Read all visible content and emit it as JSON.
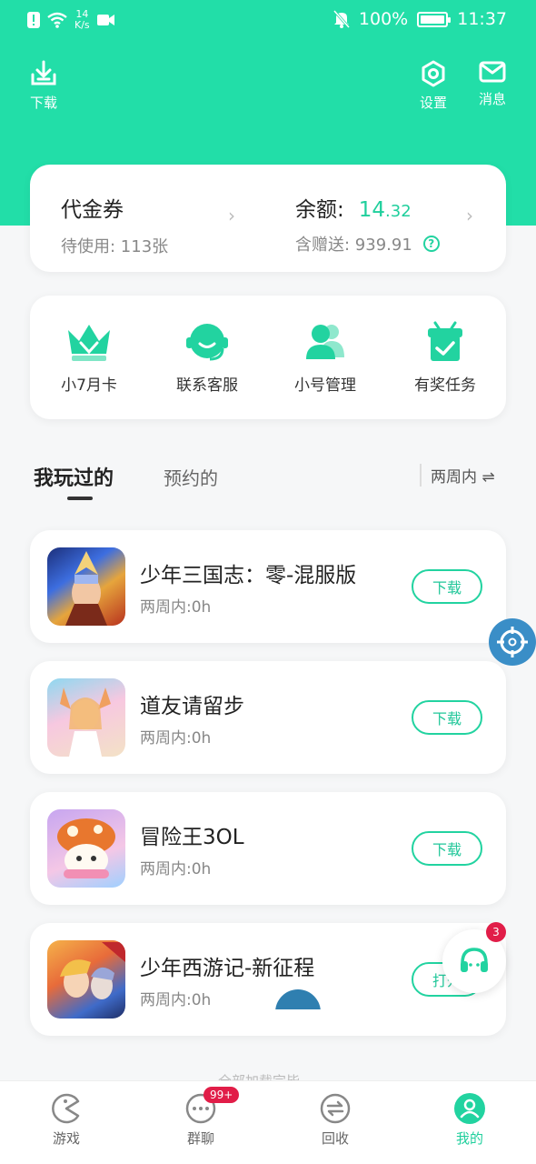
{
  "status_bar": {
    "net_speed_value": "14",
    "net_speed_unit": "K/s",
    "battery_percent": "100%",
    "time": "11:37"
  },
  "header": {
    "download_label": "下载",
    "settings_label": "设置",
    "messages_label": "消息"
  },
  "voucher": {
    "title": "代金券",
    "pending": "待使用: 113张",
    "balance_label": "余额:",
    "balance_int": "14",
    "balance_dec": ".32",
    "gift_balance": "含赠送: 939.91"
  },
  "features": [
    {
      "label": "小7月卡",
      "icon": "crown-icon"
    },
    {
      "label": "联系客服",
      "icon": "headset-icon"
    },
    {
      "label": "小号管理",
      "icon": "users-icon"
    },
    {
      "label": "有奖任务",
      "icon": "gift-icon"
    }
  ],
  "tabs": {
    "played": "我玩过的",
    "reserved": "预约的",
    "filter": "两周内 ⇌"
  },
  "games": [
    {
      "name": "少年三国志：零-混服版",
      "time": "两周内:0h",
      "button": "下载"
    },
    {
      "name": "道友请留步",
      "time": "两周内:0h",
      "button": "下载"
    },
    {
      "name": "冒险王3OL",
      "time": "两周内:0h",
      "button": "下载"
    },
    {
      "name": "少年西游记-新征程",
      "time": "两周内:0h",
      "button": "打开"
    }
  ],
  "list_end_hint": "全部加载完毕",
  "floating": {
    "badge": "3"
  },
  "bottom_nav": {
    "games": "游戏",
    "group_chat": "群聊",
    "group_badge": "99+",
    "recycle": "回收",
    "mine": "我的"
  },
  "colors": {
    "brand": "#22dea8",
    "accent_text": "#1fcf9c",
    "badge": "#e11d48"
  }
}
